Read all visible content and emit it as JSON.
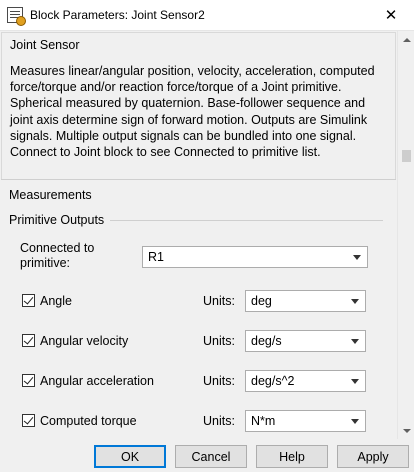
{
  "window": {
    "title": "Block Parameters: Joint Sensor2",
    "close_glyph": "✕"
  },
  "description": {
    "title": "Joint Sensor",
    "text": "Measures linear/angular position, velocity, acceleration, computed force/torque and/or reaction force/torque of a Joint primitive. Spherical measured by quaternion. Base-follower sequence and joint axis determine sign of forward motion. Outputs are Simulink signals. Multiple output signals can be bundled into one signal. Connect to Joint block to see Connected to primitive list."
  },
  "measurements": {
    "title": "Measurements",
    "primitive_outputs_title": "Primitive Outputs",
    "connected_label": "Connected to primitive:",
    "connected_value": "R1",
    "units_label": "Units:",
    "rows": [
      {
        "label": "Angle",
        "checked": true,
        "units": "deg"
      },
      {
        "label": "Angular velocity",
        "checked": true,
        "units": "deg/s"
      },
      {
        "label": "Angular acceleration",
        "checked": true,
        "units": "deg/s^2"
      },
      {
        "label": "Computed torque",
        "checked": true,
        "units": "N*m"
      }
    ]
  },
  "buttons": {
    "ok": "OK",
    "cancel": "Cancel",
    "help": "Help",
    "apply": "Apply"
  },
  "colors": {
    "panel_bg": "#f0f0f0",
    "default_button_border": "#0078d7"
  },
  "icons": [
    "block-parameters-icon",
    "close-icon",
    "scroll-up-icon",
    "scroll-down-icon",
    "dropdown-arrow-icon",
    "checkbox-checked-icon"
  ]
}
